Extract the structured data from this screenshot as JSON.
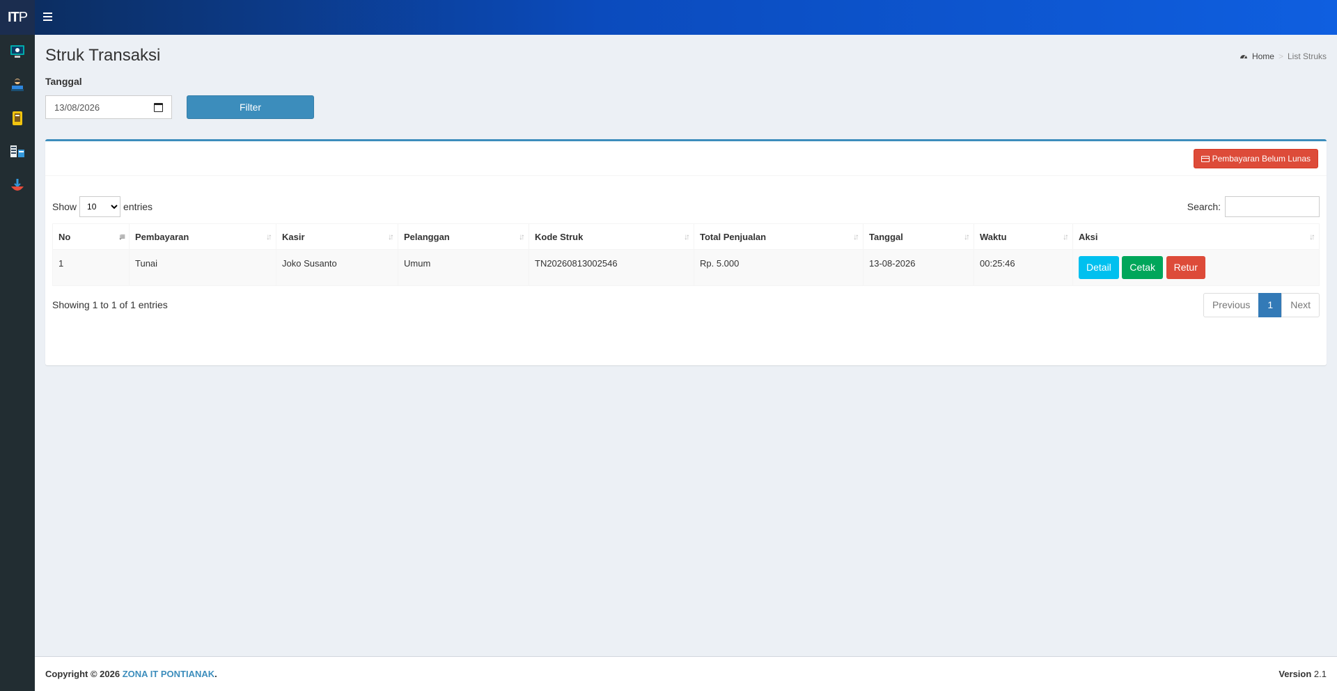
{
  "brand": {
    "logo_bold": "IT",
    "logo_rest": "P"
  },
  "sidebar": {
    "items": [
      {
        "icon": "monitor-icon"
      },
      {
        "icon": "cashier-icon"
      },
      {
        "icon": "receipt-icon"
      },
      {
        "icon": "server-icon"
      },
      {
        "icon": "return-icon"
      }
    ]
  },
  "page": {
    "title": "Struk Transaksi"
  },
  "breadcrumb": {
    "home": "Home",
    "current": "List Struks"
  },
  "filter": {
    "label": "Tanggal",
    "date_value": "13/08/2026",
    "button": "Filter"
  },
  "box": {
    "unpaid_button": "Pembayaran Belum Lunas"
  },
  "datatable": {
    "show_label": "Show",
    "entries_label": "entries",
    "page_size": "10",
    "search_label": "Search:",
    "columns": [
      "No",
      "Pembayaran",
      "Kasir",
      "Pelanggan",
      "Kode Struk",
      "Total Penjualan",
      "Tanggal",
      "Waktu",
      "Aksi"
    ],
    "rows": [
      {
        "no": "1",
        "pembayaran": "Tunai",
        "kasir": "Joko Susanto",
        "pelanggan": "Umum",
        "kode": "TN20260813002546",
        "total": "Rp. 5.000",
        "tanggal": "13-08-2026",
        "waktu": "00:25:46"
      }
    ],
    "actions": {
      "detail": "Detail",
      "cetak": "Cetak",
      "retur": "Retur"
    },
    "info": "Showing 1 to 1 of 1 entries",
    "pagination": {
      "previous": "Previous",
      "current": "1",
      "next": "Next"
    }
  },
  "footer": {
    "copyright": "Copyright © 2026",
    "company": "ZONA IT PONTIANAK",
    "dot": ".",
    "version_label": "Version",
    "version": "2.1"
  },
  "colors": {
    "primary": "#3c8dbc",
    "danger": "#dd4b39",
    "success": "#00a65a",
    "info": "#00c0ef",
    "sidebar": "#222d32"
  }
}
